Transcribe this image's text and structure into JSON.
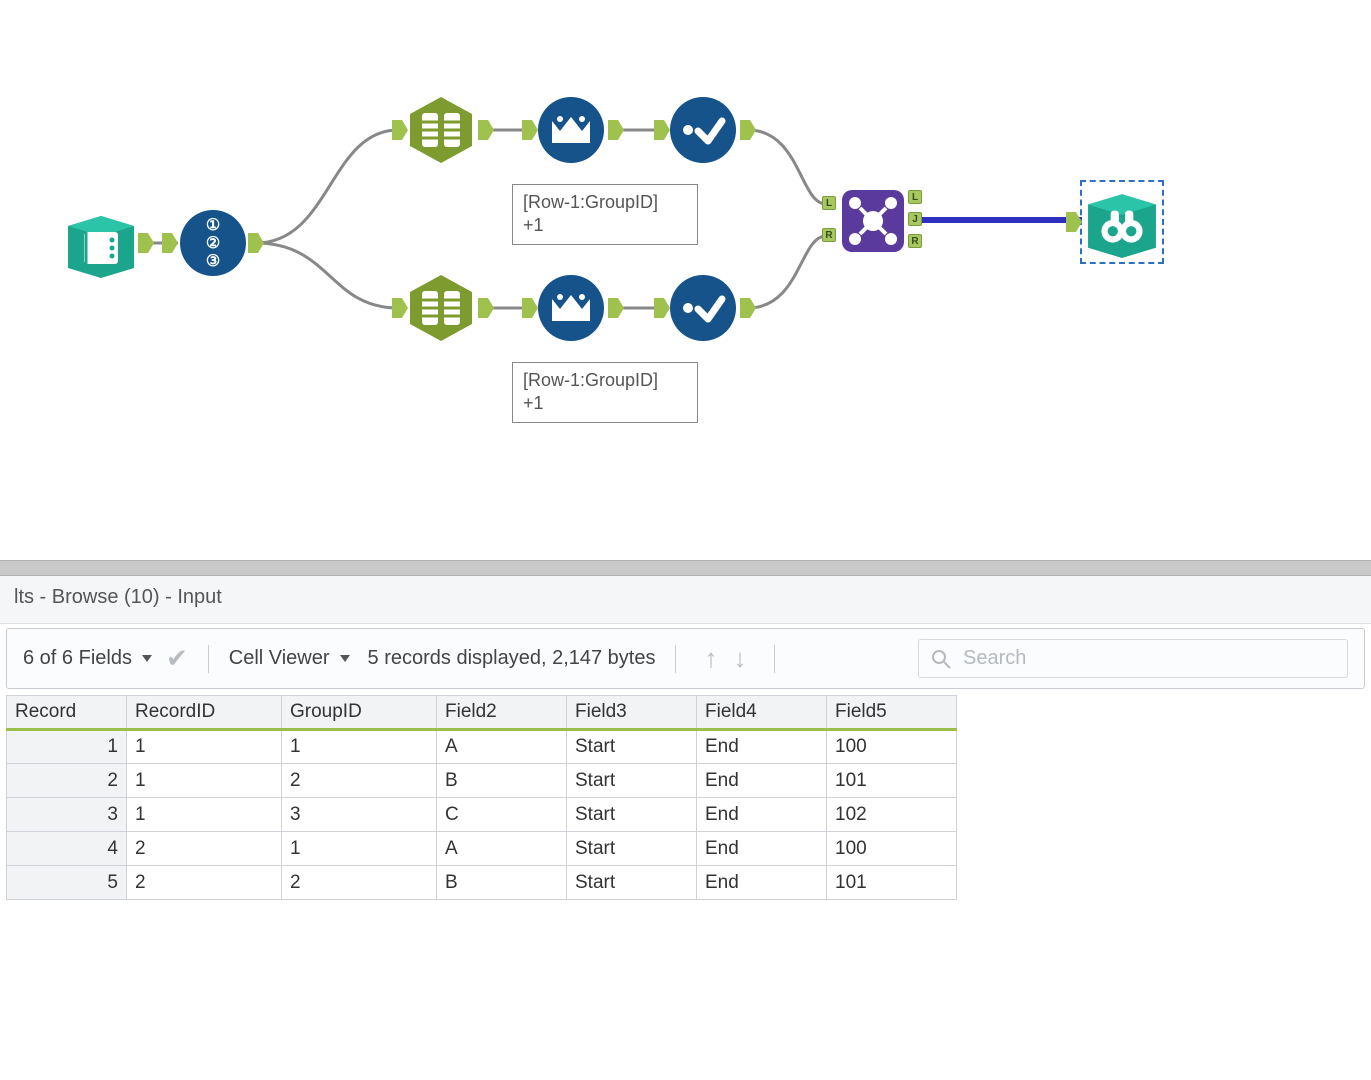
{
  "annotations": {
    "top": {
      "line1": "[Row-1:GroupID]",
      "line2": "+1"
    },
    "bottom": {
      "line1": "[Row-1:GroupID]",
      "line2": "+1"
    }
  },
  "join_anchors": {
    "L": "L",
    "J": "J",
    "R": "R"
  },
  "results": {
    "title": "lts - Browse (10) - Input",
    "fields_dd": "6 of 6 Fields",
    "cell_viewer": "Cell Viewer",
    "status": "5 records displayed, 2,147 bytes",
    "search_placeholder": "Search"
  },
  "table": {
    "headers": [
      "Record",
      "RecordID",
      "GroupID",
      "Field2",
      "Field3",
      "Field4",
      "Field5"
    ],
    "rows": [
      [
        "1",
        "1",
        "1",
        "A",
        "Start",
        "End",
        "100"
      ],
      [
        "2",
        "1",
        "2",
        "B",
        "Start",
        "End",
        "101"
      ],
      [
        "3",
        "1",
        "3",
        "C",
        "Start",
        "End",
        "102"
      ],
      [
        "4",
        "2",
        "1",
        "A",
        "Start",
        "End",
        "100"
      ],
      [
        "5",
        "2",
        "2",
        "B",
        "Start",
        "End",
        "101"
      ]
    ]
  }
}
